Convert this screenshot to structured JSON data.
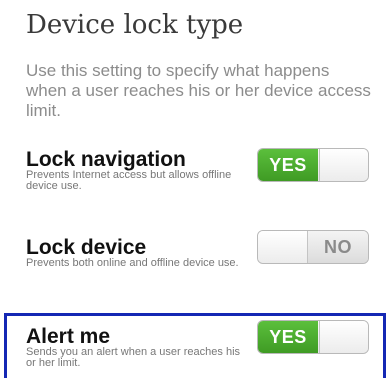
{
  "heading": "Device lock type",
  "intro": "Use this setting to specify what happens when a user reaches his or her device access limit.",
  "settings": [
    {
      "name": "Lock navigation",
      "description": "Prevents Internet access but allows offline device use.",
      "state_label": "YES",
      "enabled": true
    },
    {
      "name": "Lock device",
      "description": "Prevents both online and offline device use.",
      "state_label": "NO",
      "enabled": false
    },
    {
      "name": "Alert me",
      "description": "Sends you an alert when a user reaches his or her limit.",
      "state_label": "YES",
      "enabled": true
    }
  ],
  "colors": {
    "toggle_on": "#4aaa2e",
    "highlight_border": "#1428b4"
  }
}
